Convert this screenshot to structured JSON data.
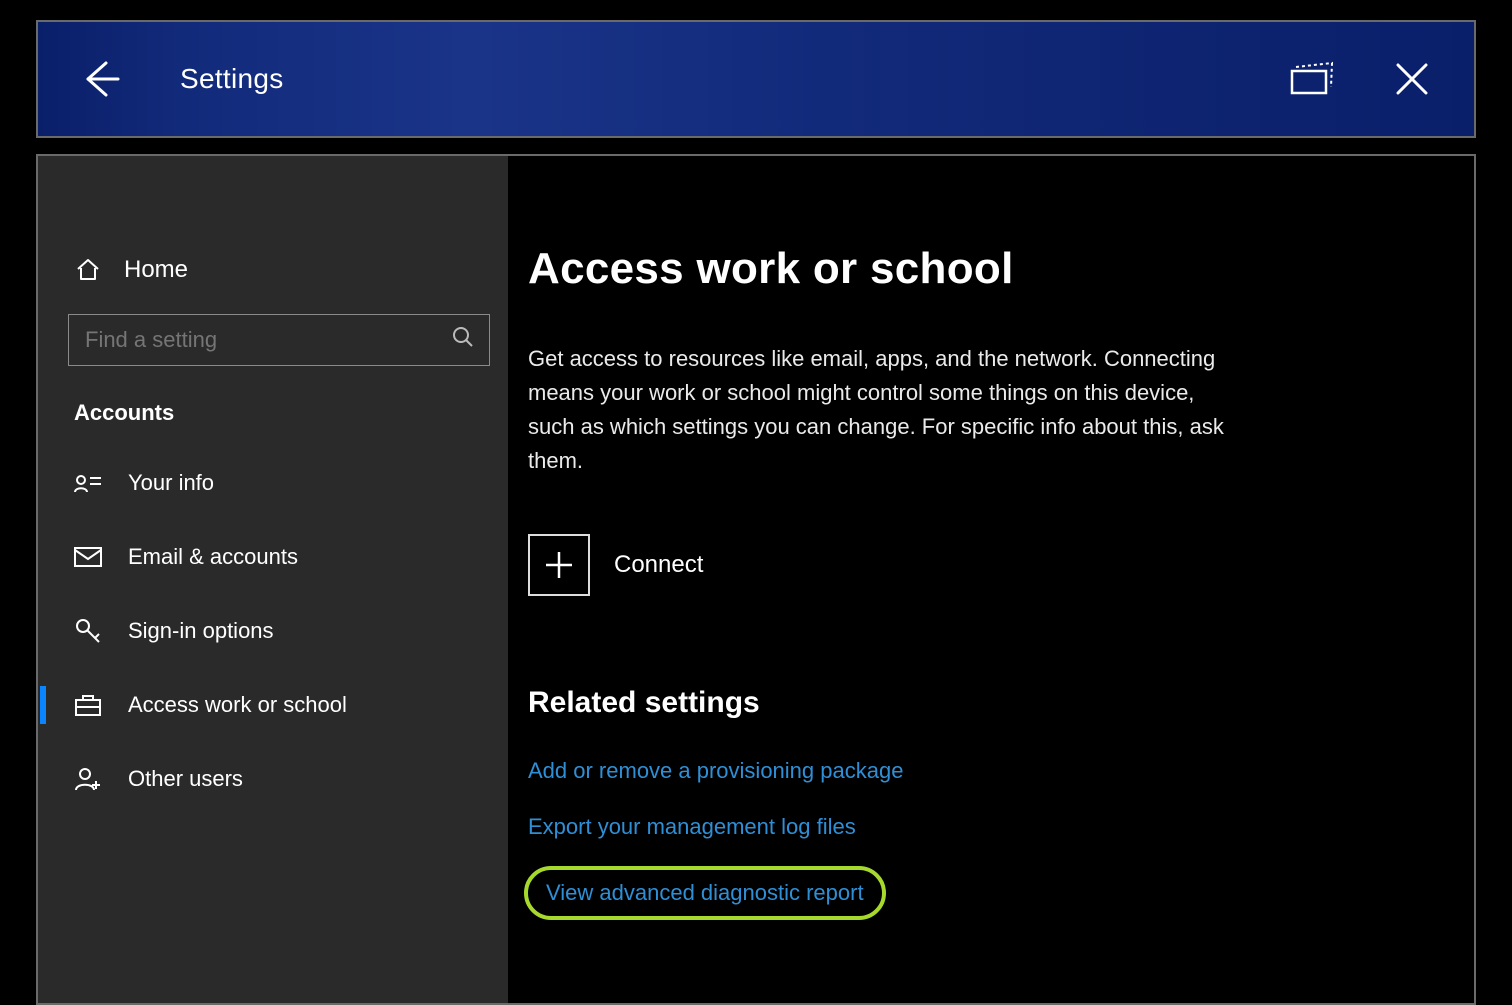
{
  "titlebar": {
    "title": "Settings"
  },
  "sidebar": {
    "home_label": "Home",
    "search_placeholder": "Find a setting",
    "category_label": "Accounts",
    "items": [
      {
        "label": "Your info"
      },
      {
        "label": "Email & accounts"
      },
      {
        "label": "Sign-in options"
      },
      {
        "label": "Access work or school"
      },
      {
        "label": "Other users"
      }
    ]
  },
  "content": {
    "heading": "Access work or school",
    "description": "Get access to resources like email, apps, and the network. Connecting means your work or school might control some things on this device, such as which settings you can change. For specific info about this, ask them.",
    "connect_label": "Connect",
    "related_heading": "Related settings",
    "links": [
      "Add or remove a provisioning package",
      "Export your management log files",
      "View advanced diagnostic report"
    ]
  }
}
